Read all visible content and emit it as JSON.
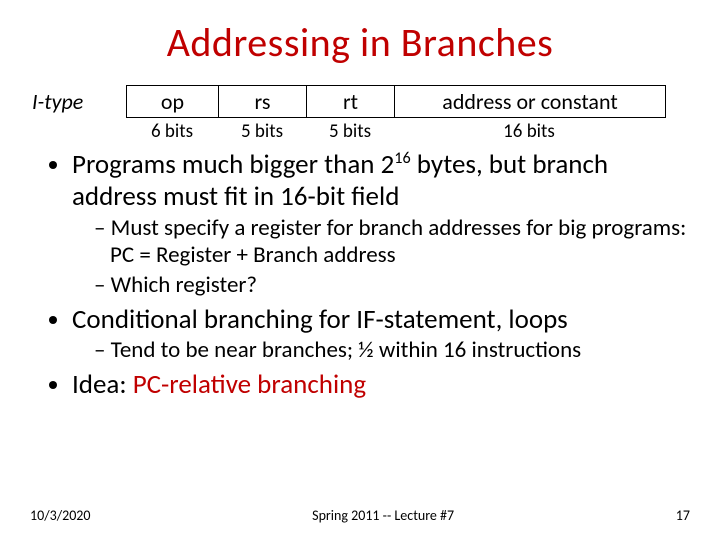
{
  "title": "Addressing in Branches",
  "format": {
    "label": "I-type",
    "fields": {
      "op": {
        "name": "op",
        "bits": "6 bits"
      },
      "rs": {
        "name": "rs",
        "bits": "5 bits"
      },
      "rt": {
        "name": "rt",
        "bits": "5 bits"
      },
      "addr": {
        "name": "address or constant",
        "bits": "16 bits"
      }
    }
  },
  "bullets": {
    "b1a": "Programs much bigger than 2",
    "b1exp": "16",
    "b1b": " bytes, but branch address must fit in 16-bit field",
    "b1s1": "Must specify a register for branch addresses for big programs: PC = Register + Branch address",
    "b1s2": "Which register?",
    "b2": "Conditional branching for IF-statement, loops",
    "b2s1": "Tend to be near branches; ½ within 16 instructions",
    "b3a": "Idea: ",
    "b3b": "PC-relative branching"
  },
  "footer": {
    "left": "10/3/2020",
    "center": "Spring 2011 -- Lecture #7",
    "right": "17"
  }
}
